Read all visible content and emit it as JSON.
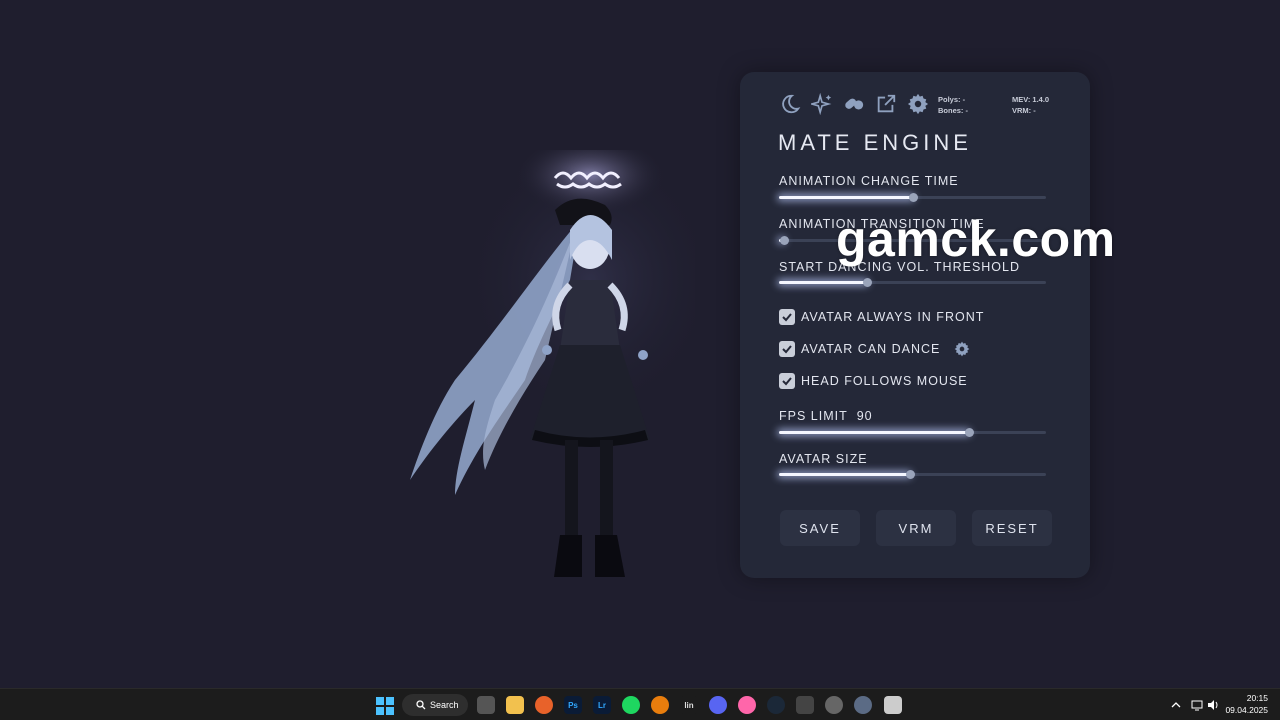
{
  "panel": {
    "toolbar_icons": [
      "moon-icon",
      "sparkles-icon",
      "pills-icon",
      "external-link-icon",
      "gear-icon"
    ],
    "stats": {
      "polys": "Polys: -",
      "bones": "Bones: -",
      "mev": "MEV: 1.4.0",
      "vrm": "VRM: -"
    },
    "title": "MATE ENGINE",
    "sliders": [
      {
        "label": "ANIMATION CHANGE TIME",
        "value": 0.5
      },
      {
        "label": "ANIMATION TRANSITION TIME",
        "value": 0.02
      },
      {
        "label": "START DANCING VOL. THRESHOLD",
        "value": 0.33
      }
    ],
    "checkboxes": [
      {
        "label": "AVATAR ALWAYS IN FRONT",
        "checked": true
      },
      {
        "label": "AVATAR CAN DANCE",
        "checked": true
      },
      {
        "label": "HEAD FOLLOWS MOUSE",
        "checked": true
      }
    ],
    "fps": {
      "label": "FPS LIMIT",
      "value_text": "90",
      "slider_value": 0.71
    },
    "avatar_size": {
      "label": "AVATAR SIZE",
      "slider_value": 0.49
    },
    "buttons": {
      "save": "SAVE",
      "vrm": "VRM",
      "reset": "RESET"
    },
    "accent_color": "#f4f6ff"
  },
  "watermark": "gamck.com",
  "taskbar": {
    "search_label": "Search",
    "apps": [
      "file-manager",
      "file-explorer",
      "firefox",
      "photoshop",
      "lightroom",
      "spotify",
      "blender",
      "linear-app",
      "discord",
      "osu",
      "steam",
      "unity",
      "mate-engine",
      "settings",
      "mate-engine-active"
    ],
    "ps_text": "Ps",
    "lr_text": "Lr",
    "lin_text": "lin",
    "time": "20:15",
    "date": "09.04.2025"
  }
}
